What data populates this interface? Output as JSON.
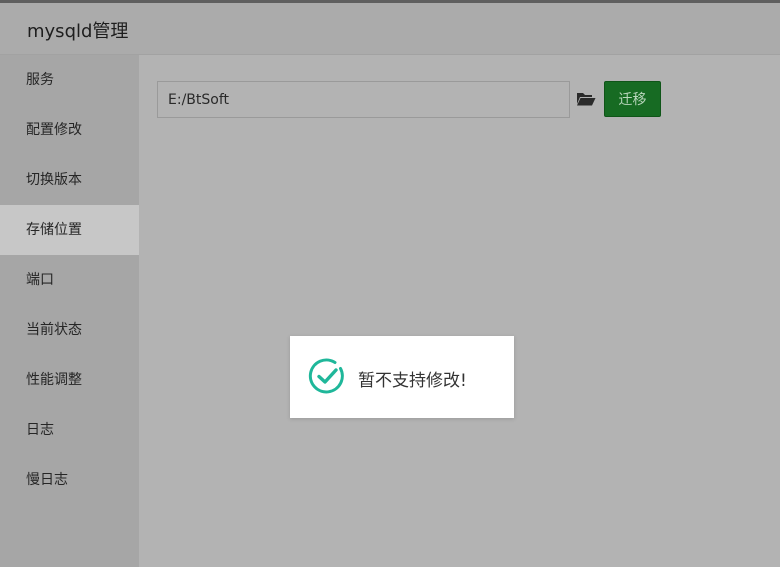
{
  "window": {
    "title": "mysqld管理"
  },
  "sidebar": {
    "items": [
      {
        "label": "服务",
        "active": false
      },
      {
        "label": "配置修改",
        "active": false
      },
      {
        "label": "切换版本",
        "active": false
      },
      {
        "label": "存储位置",
        "active": true
      },
      {
        "label": "端口",
        "active": false
      },
      {
        "label": "当前状态",
        "active": false
      },
      {
        "label": "性能调整",
        "active": false
      },
      {
        "label": "日志",
        "active": false
      },
      {
        "label": "慢日志",
        "active": false
      }
    ]
  },
  "storage": {
    "path_value": "E:/BtSoft",
    "folder_icon": "folder-open-icon",
    "migrate_label": "迁移"
  },
  "toast": {
    "icon": "check-circle-icon",
    "message": "暂不支持修改!"
  },
  "colors": {
    "migrate_button": "#176b23",
    "toast_check": "#1fb79a"
  }
}
